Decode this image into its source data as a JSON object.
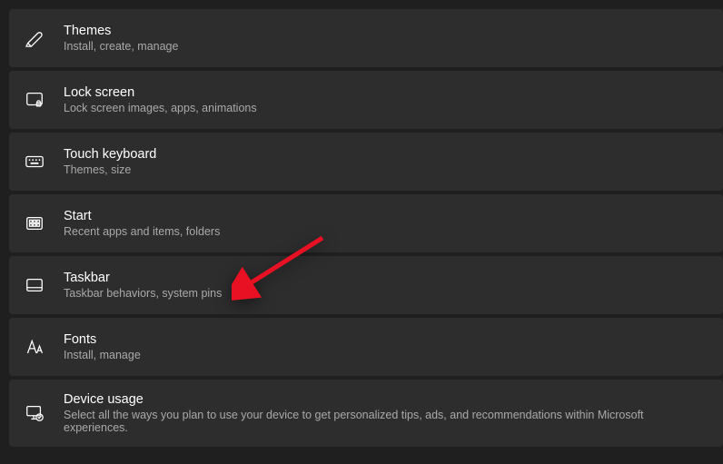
{
  "items": [
    {
      "title": "Themes",
      "subtitle": "Install, create, manage"
    },
    {
      "title": "Lock screen",
      "subtitle": "Lock screen images, apps, animations"
    },
    {
      "title": "Touch keyboard",
      "subtitle": "Themes, size"
    },
    {
      "title": "Start",
      "subtitle": "Recent apps and items, folders"
    },
    {
      "title": "Taskbar",
      "subtitle": "Taskbar behaviors, system pins"
    },
    {
      "title": "Fonts",
      "subtitle": "Install, manage"
    },
    {
      "title": "Device usage",
      "subtitle": "Select all the ways you plan to use your device to get personalized tips, ads, and recommendations within Microsoft experiences."
    }
  ]
}
